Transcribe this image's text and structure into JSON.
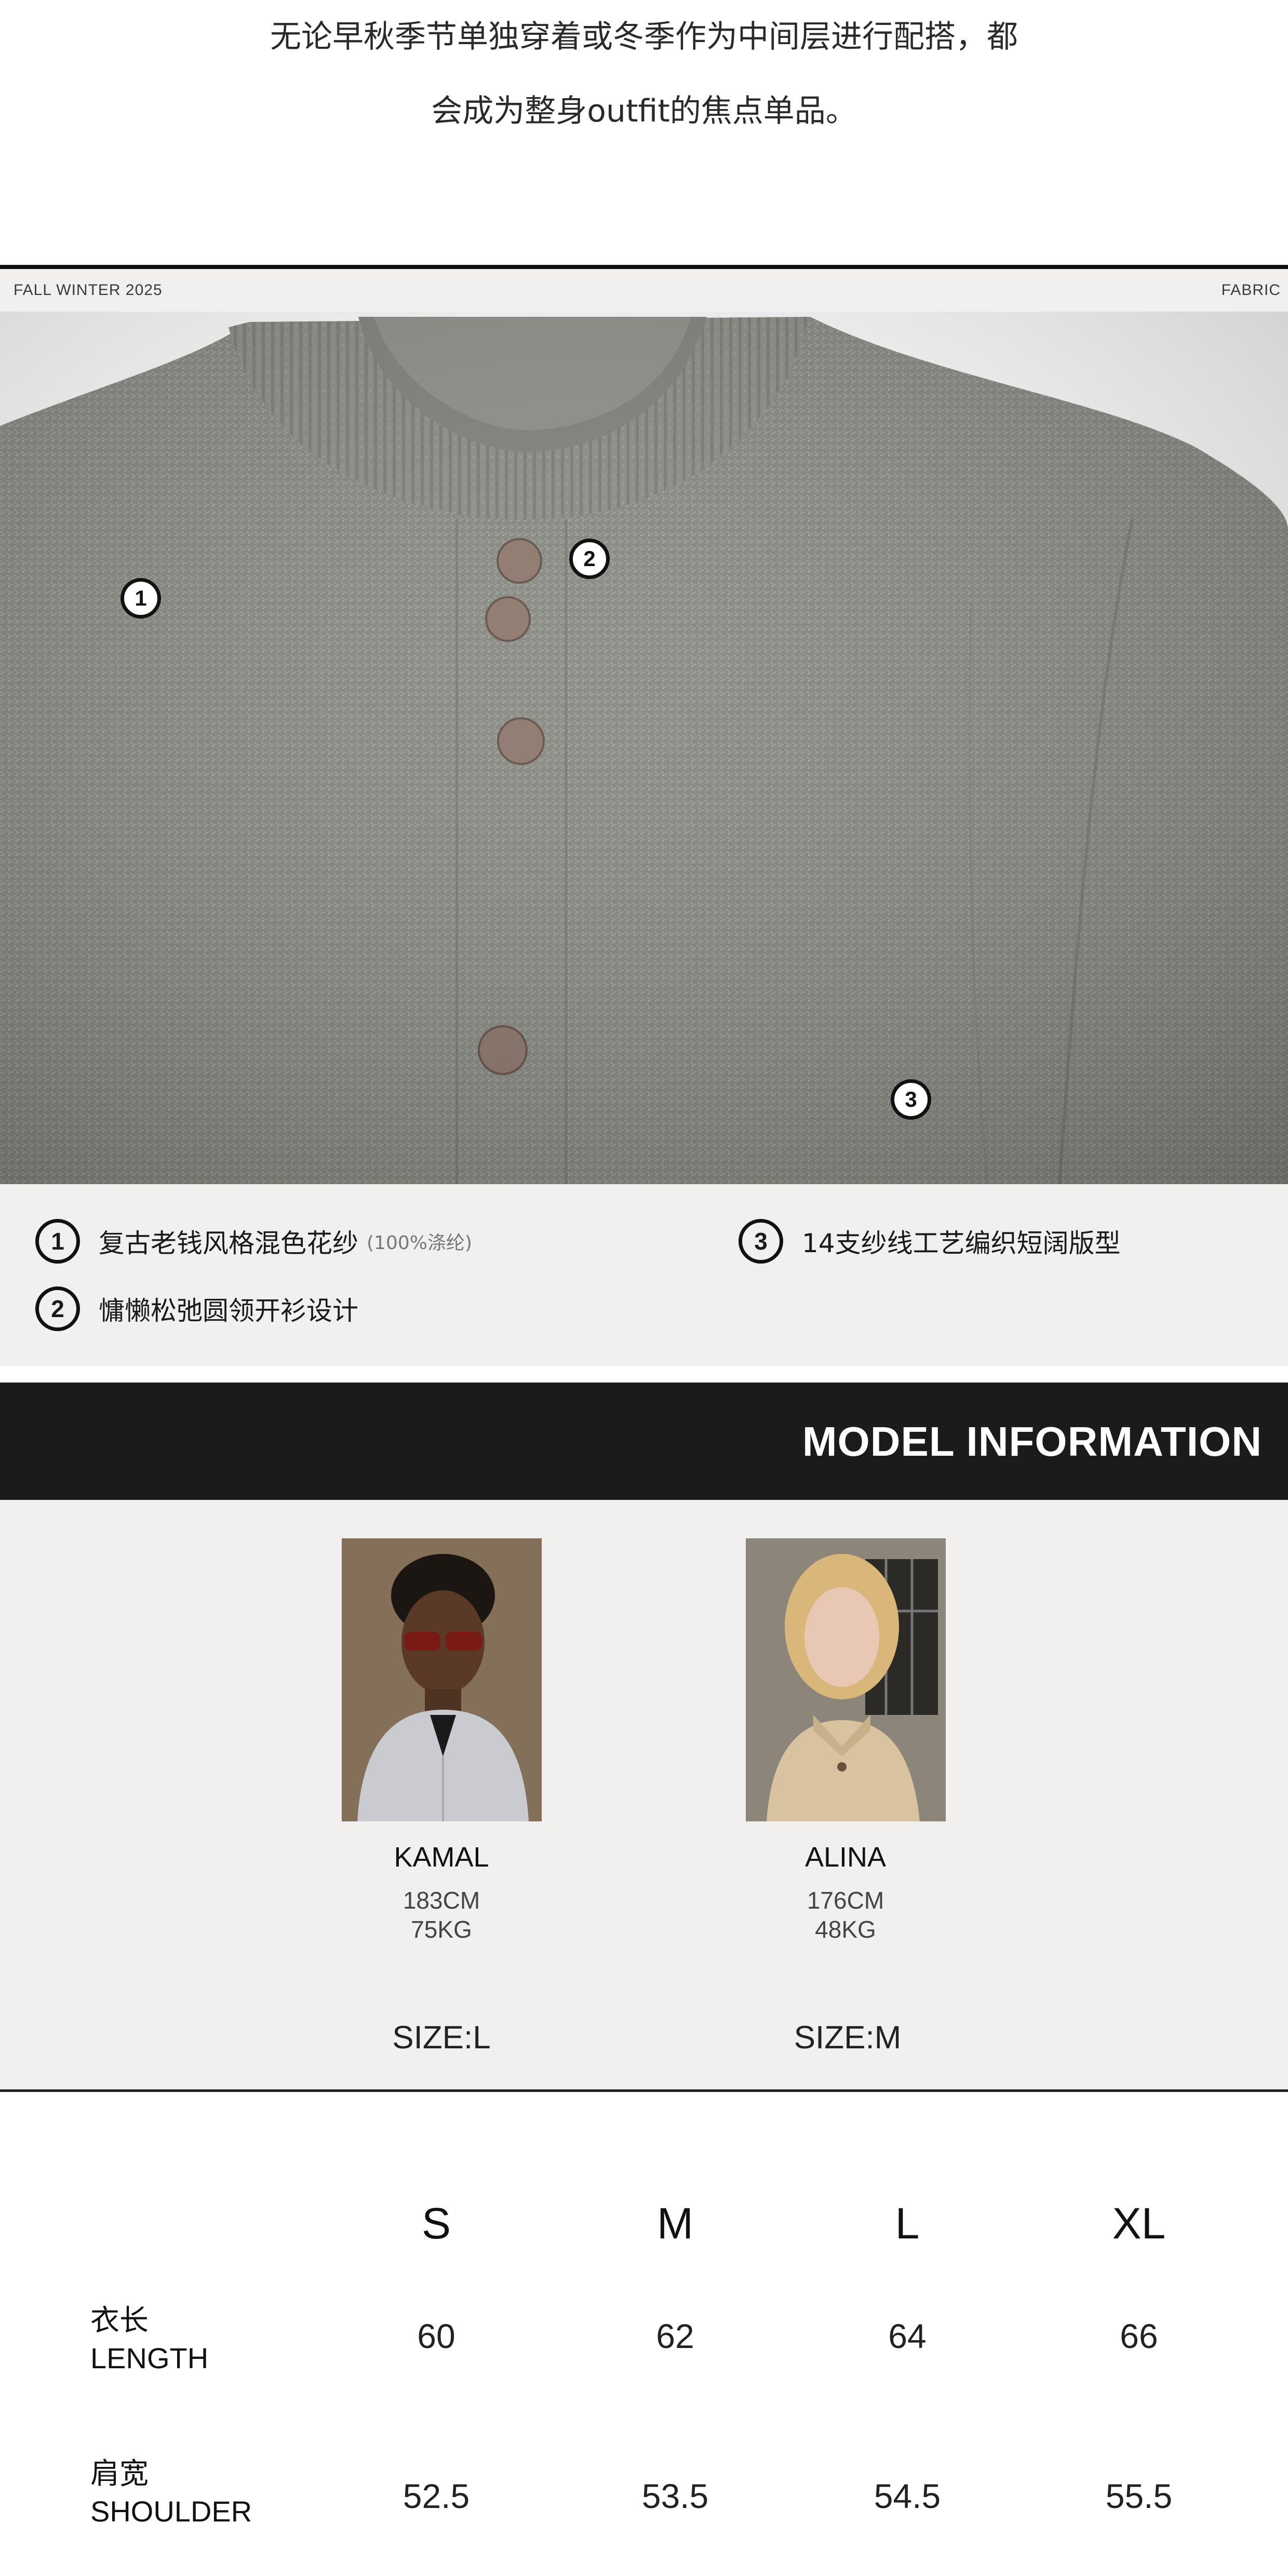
{
  "intro": {
    "line1": "无论早秋季节单独穿着或冬季作为中间层进行配搭，都",
    "line2": "会成为整身outfit的焦点单品。"
  },
  "fabric": {
    "season": "FALL WINTER 2025",
    "section": "FABRIC",
    "markers": [
      "1",
      "2",
      "3"
    ],
    "features": [
      {
        "num": "1",
        "text": "复古老钱风格混色花纱",
        "note": "(100%涤纶)"
      },
      {
        "num": "2",
        "text": "慵懒松弛圆领开衫设计",
        "note": ""
      },
      {
        "num": "3",
        "text": "14支纱线工艺编织短阔版型",
        "note": ""
      }
    ],
    "colors": {
      "knit": "#858580",
      "button": "#8a7468"
    }
  },
  "model_info": {
    "title": "MODEL INFORMATION",
    "models": [
      {
        "name": "KAMAL",
        "height": "183CM",
        "weight": "75KG",
        "size": "SIZE:L"
      },
      {
        "name": "ALINA",
        "height": "176CM",
        "weight": "48KG",
        "size": "SIZE:M"
      }
    ]
  },
  "size_chart": {
    "sizes": [
      "S",
      "M",
      "L",
      "XL"
    ],
    "rows": [
      {
        "label_cn": "衣长",
        "label_en": "LENGTH",
        "values": [
          "60",
          "62",
          "64",
          "66"
        ]
      },
      {
        "label_cn": "肩宽",
        "label_en": "SHOULDER",
        "values": [
          "52.5",
          "53.5",
          "54.5",
          "55.5"
        ]
      }
    ]
  }
}
